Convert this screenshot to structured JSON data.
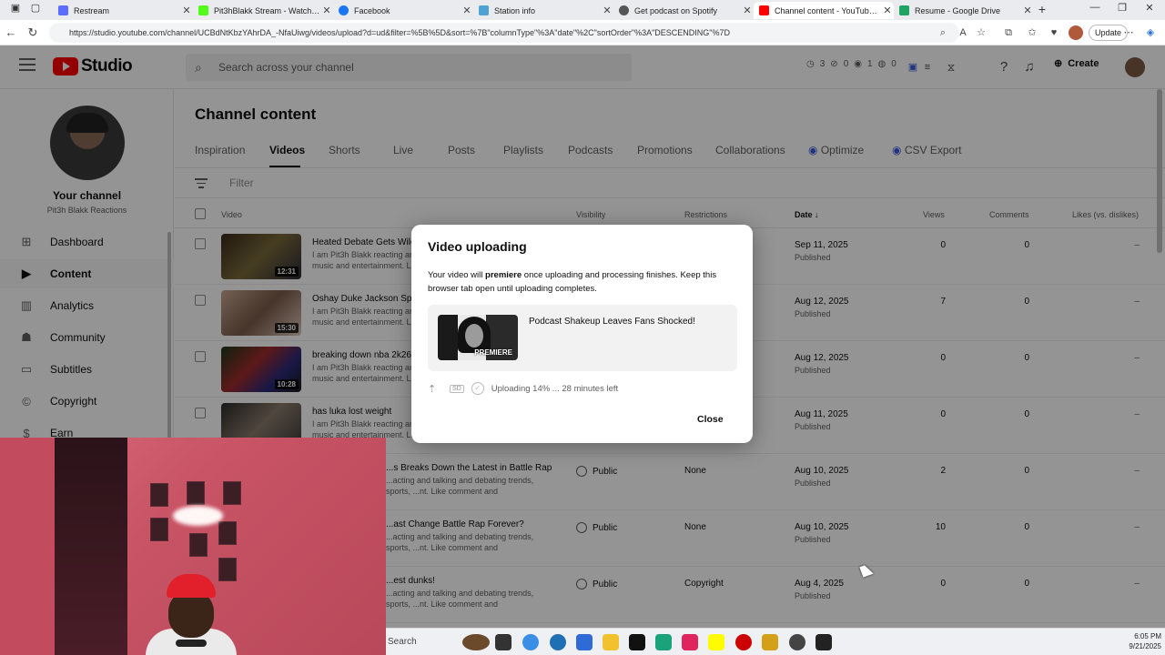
{
  "browser": {
    "tabs": [
      {
        "title": "Restream",
        "color": "#5b6cff",
        "active": false
      },
      {
        "title": "Pit3hBlakk Stream - Watch Live",
        "color": "#53fc18",
        "active": false
      },
      {
        "title": "Facebook",
        "color": "#1877f2",
        "active": false
      },
      {
        "title": "Station info",
        "color": "#4fa3d1",
        "active": false
      },
      {
        "title": "Get podcast on Spotify",
        "color": "#555555",
        "active": false
      },
      {
        "title": "Channel content - YouTube Studio",
        "color": "#ff0000",
        "active": true
      },
      {
        "title": "Resume - Google Drive",
        "color": "#1fa463",
        "active": false
      }
    ],
    "url": "https://studio.youtube.com/channel/UCBdNtKbzYAhrDA_-NfaUiwg/videos/upload?d=ud&filter=%5B%5D&sort=%7B\"columnType\"%3A\"date\"%2C\"sortOrder\"%3A\"DESCENDING\"%7D",
    "update_label": "Update"
  },
  "header": {
    "logo_text": "Studio",
    "search_placeholder": "Search across your channel",
    "stats": [
      "3",
      "0",
      "1",
      "0"
    ],
    "create_label": "Create"
  },
  "sidebar": {
    "channel_title": "Your channel",
    "channel_name": "Pit3h Blakk Reactions",
    "items": [
      {
        "label": "Dashboard",
        "icon": "⊞",
        "active": false
      },
      {
        "label": "Content",
        "icon": "▶",
        "active": true
      },
      {
        "label": "Analytics",
        "icon": "▥",
        "active": false
      },
      {
        "label": "Community",
        "icon": "☗",
        "active": false
      },
      {
        "label": "Subtitles",
        "icon": "▭",
        "active": false
      },
      {
        "label": "Copyright",
        "icon": "©",
        "active": false
      },
      {
        "label": "Earn",
        "icon": "$",
        "active": false
      }
    ]
  },
  "main": {
    "title": "Channel content",
    "tabs": [
      "Inspiration",
      "Videos",
      "Shorts",
      "Live",
      "Posts",
      "Playlists",
      "Podcasts",
      "Promotions",
      "Collaborations",
      "Optimize",
      "CSV Export"
    ],
    "filter_placeholder": "Filter",
    "columns": {
      "video": "Video",
      "visibility": "Visibility",
      "restrictions": "Restrictions",
      "date": "Date ↓",
      "views": "Views",
      "comments": "Comments",
      "likes": "Likes (vs. dislikes)"
    },
    "rows": [
      {
        "title": "Heated Debate Gets Wild",
        "desc": "I am Pit3h Blakk reacting and talking and debating trends, sports, music and entertainment. Like comment and subscribe.Follow ...",
        "duration": "12:31",
        "visibility": "",
        "restrictions": "",
        "date": "Sep 11, 2025",
        "status": "Published",
        "views": "0",
        "comments": "0",
        "likes": "–"
      },
      {
        "title": "Oshay Duke Jackson Speaks",
        "desc": "I am Pit3h Blakk reacting and talking and debating trends, sports, music and entertainment. Like comment and subscribe.Follow ...",
        "duration": "15:30",
        "visibility": "",
        "restrictions": "",
        "date": "Aug 12, 2025",
        "status": "Published",
        "views": "7",
        "comments": "0",
        "likes": "–"
      },
      {
        "title": "breaking down nba 2k26",
        "desc": "I am Pit3h Blakk reacting and talking and debating trends, sports, music and entertainment. Like comment and subscribe.Follow ...",
        "duration": "10:28",
        "visibility": "",
        "restrictions": "",
        "date": "Aug 12, 2025",
        "status": "Published",
        "views": "0",
        "comments": "0",
        "likes": "–"
      },
      {
        "title": "has luka lost weight",
        "desc": "I am Pit3h Blakk reacting and talking and debating trends, sports, music and entertainment. Like comment and subscribe.Follow ...",
        "duration": "",
        "visibility": "",
        "restrictions": "",
        "date": "Aug 11, 2025",
        "status": "Published",
        "views": "0",
        "comments": "0",
        "likes": "–"
      },
      {
        "title": "...s Breaks Down the Latest in Battle Rap",
        "desc": "...acting and talking and debating trends, sports, ...nt. Like comment and subscribe.Follow ...",
        "duration": "",
        "visibility": "Public",
        "restrictions": "None",
        "date": "Aug 10, 2025",
        "status": "Published",
        "views": "2",
        "comments": "0",
        "likes": "–"
      },
      {
        "title": "...ast Change Battle Rap Forever?",
        "desc": "...acting and talking and debating trends, sports, ...nt. Like comment and subscribe.Follow ...",
        "duration": "",
        "visibility": "Public",
        "restrictions": "None",
        "date": "Aug 10, 2025",
        "status": "Published",
        "views": "10",
        "comments": "0",
        "likes": "–"
      },
      {
        "title": "...est dunks!",
        "desc": "...acting and talking and debating trends, sports, ...nt. Like comment and subscribe.Follow ...",
        "duration": "",
        "visibility": "Public",
        "restrictions": "Copyright",
        "date": "Aug 4, 2025",
        "status": "Published",
        "views": "0",
        "comments": "0",
        "likes": "–"
      }
    ]
  },
  "dialog": {
    "title": "Video uploading",
    "message_prefix": "Your video will ",
    "message_bold": "premiere",
    "message_suffix": " once uploading and processing finishes. Keep this browser tab open until uploading completes.",
    "video_title": "Podcast Shakeup Leaves Fans Shocked!",
    "badge": "PREMIERE",
    "sd_label": "SD",
    "progress_text": "Uploading 14% ... 28 minutes left",
    "progress_percent": 14,
    "close_label": "Close"
  },
  "taskbar": {
    "search_label": "Search",
    "time": "6:05 PM",
    "date": "9/21/2025"
  }
}
